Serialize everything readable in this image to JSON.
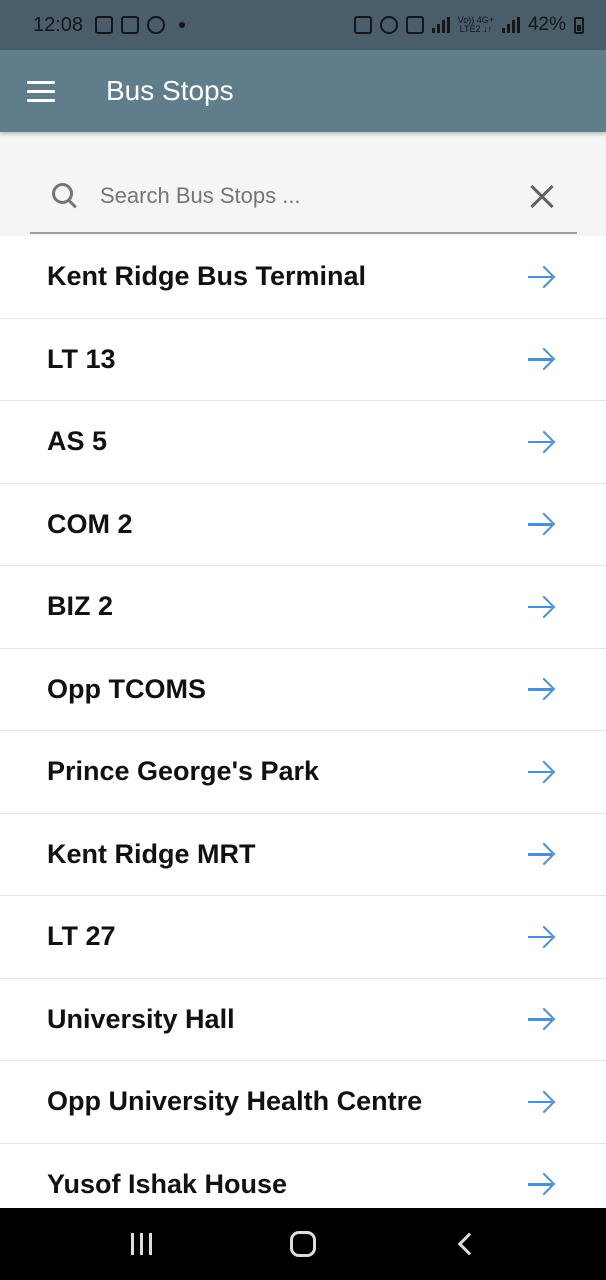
{
  "status_bar": {
    "time": "12:08",
    "battery": "42%",
    "network_top": "Vo)) 4G+",
    "network_bottom": "LTE2 ↓↑",
    "left_icons": [
      "samsung-pay-icon",
      "gallery-icon",
      "bug-icon",
      "dot-icon"
    ],
    "right_icons": [
      "lock-icon",
      "alarm-icon",
      "mute-icon",
      "signal-icon",
      "signal-icon",
      "battery-icon"
    ]
  },
  "app_bar": {
    "title": "Bus Stops",
    "menu_icon": "menu-icon",
    "background": "#607d8b"
  },
  "search": {
    "placeholder": "Search Bus Stops ...",
    "value": "",
    "icon": "search-icon",
    "clear_icon": "close-icon"
  },
  "stops": [
    {
      "name": "Kent Ridge Bus Terminal"
    },
    {
      "name": "LT 13"
    },
    {
      "name": "AS 5"
    },
    {
      "name": "COM 2"
    },
    {
      "name": "BIZ 2"
    },
    {
      "name": "Opp TCOMS"
    },
    {
      "name": "Prince George's Park"
    },
    {
      "name": "Kent Ridge MRT"
    },
    {
      "name": "LT 27"
    },
    {
      "name": "University Hall"
    },
    {
      "name": "Opp University Health Centre"
    },
    {
      "name": "Yusof Ishak House"
    }
  ],
  "stop_item_icon": "arrow-right-icon",
  "accent_color": "#4a90d9",
  "nav_bar": {
    "buttons": [
      "recents-icon",
      "home-icon",
      "back-icon"
    ]
  }
}
